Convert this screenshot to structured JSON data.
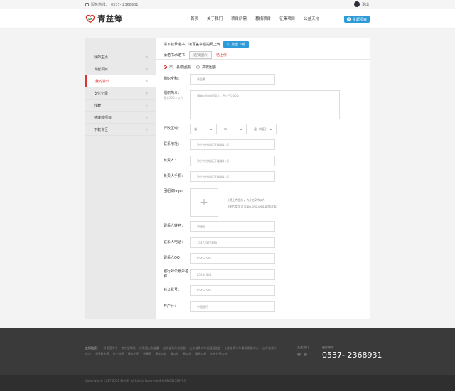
{
  "topbar": {
    "phone_label": "服务热线：",
    "phone": "0537- 2368931",
    "login": "退出"
  },
  "header": {
    "logo_text": "青益筹",
    "nav": [
      "首页",
      "关于我们",
      "项目所需",
      "募捐项目",
      "征集项目",
      "公益天地"
    ],
    "start_button": "发起项目"
  },
  "sidebar": {
    "items": [
      {
        "label": "我的主页",
        "active": false
      },
      {
        "label": "发起项目",
        "active": false
      },
      {
        "label": "我的资料",
        "active": true
      },
      {
        "label": "支付记录",
        "active": false
      },
      {
        "label": "收藏",
        "active": false
      },
      {
        "label": "待审核项目",
        "active": false
      },
      {
        "label": "下载专区",
        "active": false
      }
    ]
  },
  "main": {
    "notice": "请下载承诺书，填写盖章后拍照上传",
    "upload_button": "点击下载",
    "tab_label": "承诺书承诺书",
    "file_button": "选择图片",
    "uploaded": "已上传",
    "radio_options": [
      "市、县级团委",
      "高校团委"
    ],
    "org_name_label": "组织全称：",
    "org_name_placeholder": "青益筹",
    "org_intro_label": "组织简介：",
    "org_intro_sub": "最长200字以内",
    "org_intro_placeholder": "请输入你组织简介，不少于200字",
    "region_label": "行政区域：",
    "region_selects": [
      "省",
      "市",
      "县（市区）"
    ],
    "address_label": "联系地址：",
    "address_value": "济宁市任城区开鑫路11号",
    "person_label": "负责人：",
    "person_value": "济宁市任城区开鑫路11号",
    "person_phone_label": "负责人手机：",
    "person_phone_value": "济宁市任城区开鑫路11号",
    "logo_label": "团组织logo：",
    "logo_hint_1": "(建上传图片，大小在2M以内",
    "logo_hint_2": "(图片类型可为jpg,png,jpeg,gif,bmp)",
    "contact_name_label": "联系人姓名：",
    "contact_name_value": "润涵园",
    "contact_phone_label": "联系人电话：",
    "contact_phone_value": "13275377893",
    "contact_qq_label": "联系人QQ：",
    "contact_qq_value": "85454545",
    "bank_account_label": "银行对公账户名称：",
    "bank_account_value": "85454545",
    "public_account_label": "对公账号：",
    "public_account_value": "85454545",
    "bank_label": "开户行：",
    "bank_value": "中国银行"
  },
  "footer": {
    "links_lead": "友情链接：",
    "links": [
      "共青团济宁",
      "济宁宝华网",
      "共青团山东省委",
      "山东省青年志愿者",
      "山东省青少年发展基金会",
      "山东省青少年事业发展中心",
      "山东省青少年宫",
      "中国青年报",
      "济宁校园",
      "青年之声",
      "中青网",
      "青年公益",
      "微公益",
      "易公益",
      "腾讯公益",
      "山东共享公益"
    ],
    "follow_label": "关注我们",
    "hotline_label": "服务热线",
    "hotline": "0537- 2368931",
    "copyright": "Copyright © 2017-2018 青益筹. All Rights Reserved    鲁ICP备05112970号"
  }
}
